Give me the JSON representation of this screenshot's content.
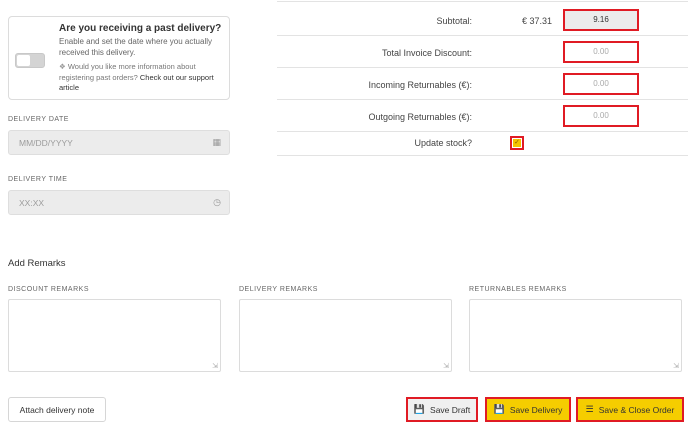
{
  "past_delivery": {
    "title": "Are you receiving a past delivery?",
    "description": "Enable and set the date where you actually received this delivery.",
    "info_text": "Would you like more information about registering past orders?",
    "info_link": "Check out our support article",
    "toggle_on": false
  },
  "delivery_date": {
    "label": "DELIVERY DATE",
    "placeholder": "MM/DD/YYYY",
    "icon": "calendar-icon"
  },
  "delivery_time": {
    "label": "DELIVERY TIME",
    "placeholder": "XX:XX",
    "icon": "clock-icon"
  },
  "summary": {
    "subtotal_label": "Subtotal:",
    "subtotal_currency": "€ 37.31",
    "subtotal_value": "9.16",
    "discount_label": "Total Invoice Discount:",
    "discount_value": "0.00",
    "incoming_label": "Incoming Returnables (€):",
    "incoming_value": "0.00",
    "outgoing_label": "Outgoing Returnables (€):",
    "outgoing_value": "0.00",
    "update_stock_label": "Update stock?",
    "update_stock_checked": true
  },
  "remarks": {
    "title": "Add Remarks",
    "discount_label": "DISCOUNT REMARKS",
    "delivery_label": "DELIVERY REMARKS",
    "returnables_label": "RETURNABLES REMARKS"
  },
  "actions": {
    "attach_label": "Attach delivery note",
    "save_draft_label": "Save Draft",
    "save_delivery_label": "Save Delivery",
    "save_close_label": "Save & Close Order"
  },
  "colors": {
    "highlight": "#e01b24",
    "accent": "#f5cd00"
  }
}
